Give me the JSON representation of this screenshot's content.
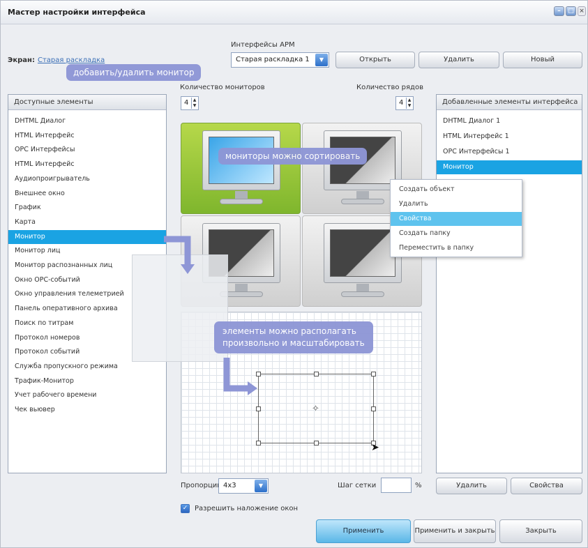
{
  "window": {
    "title": "Мастер настройки интерфейса"
  },
  "screen": {
    "label": "Экран:",
    "value": "Старая раскладка"
  },
  "arm": {
    "label": "Интерфейсы АРМ",
    "selected": "Старая раскладка 1",
    "open": "Открыть",
    "delete": "Удалить",
    "new": "Новый"
  },
  "callouts": {
    "add_remove": "добавить/удалить монитор",
    "sortable": "мониторы можно сортировать",
    "layout_1": "элементы можно располагать",
    "layout_2": "произвольно и масштабировать"
  },
  "counts": {
    "monitors_label": "Количество мониторов",
    "monitors_value": "4",
    "rows_label": "Количество рядов",
    "rows_value": "4"
  },
  "available": {
    "header": "Доступные элементы",
    "items": [
      "DHTML Диалог",
      "HTML Интерфейс",
      "OPC Интерфейсы",
      "HTML Интерфейс",
      "Аудиопроигрыватель",
      "Внешнее окно",
      "График",
      "Карта",
      "Монитор",
      "Монитор лиц",
      "Монитор распознанных лиц",
      "Окно OPC-событий",
      "Окно управления телеметрией",
      "Панель оперативного архива",
      "Поиск по титрам",
      "Протокол номеров",
      "Протокол событий",
      "Служба пропускного режима",
      "Трафик-Монитор",
      "Учет рабочего времени",
      "Чек вьювер"
    ],
    "selected_index": 8
  },
  "added": {
    "header": "Добавленные элементы интерфейса",
    "items": [
      "DHTML Диалог 1",
      "HTML Интерфейс 1",
      "OPC Интерфейсы 1",
      "Монитор"
    ],
    "selected_index": 3
  },
  "context_menu": {
    "items": [
      "Создать объект",
      "Удалить",
      "Свойства",
      "Создать папку",
      "Переместить в папку"
    ],
    "selected_index": 2
  },
  "bottom": {
    "proportion_label": "Пропорции",
    "proportion_value": "4x3",
    "grid_step_label": "Шаг сетки",
    "grid_step_unit": "%",
    "overlap_label": "Разрешить наложение окон",
    "overlap_checked": true,
    "delete": "Удалить",
    "properties": "Свойства",
    "apply": "Применить",
    "apply_close": "Применить и закрыть",
    "close": "Закрыть"
  },
  "icons": {
    "minimize": "minimize-icon",
    "maximize": "maximize-icon",
    "close": "close-icon",
    "dropdown": "chevron-down-icon",
    "cursor": "cursor-icon",
    "move": "move-icon"
  }
}
